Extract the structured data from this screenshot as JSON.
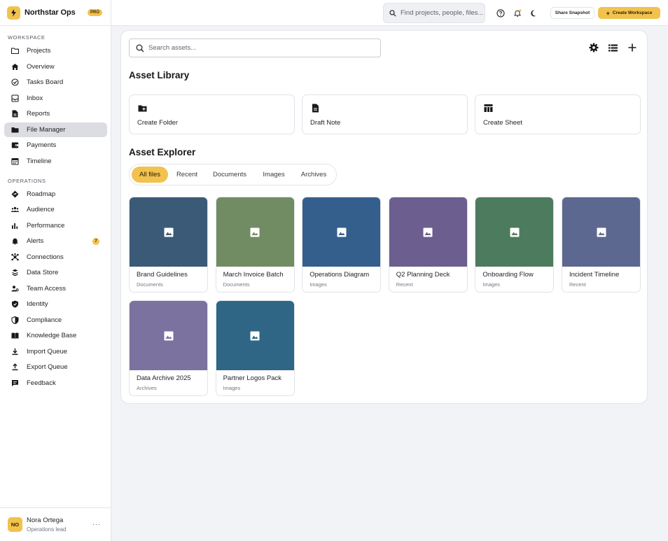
{
  "brand": {
    "name": "Northstar Ops",
    "badge": "PRO"
  },
  "sidebar": {
    "workspace_label": "WORKSPACE",
    "operations_label": "OPERATIONS",
    "workspace_items": [
      {
        "label": "Projects",
        "icon": "folder-outline-icon"
      },
      {
        "label": "Overview",
        "icon": "home-icon"
      },
      {
        "label": "Tasks Board",
        "icon": "check-circle-icon"
      },
      {
        "label": "Inbox",
        "icon": "inbox-icon"
      },
      {
        "label": "Reports",
        "icon": "document-icon"
      },
      {
        "label": "File Manager",
        "icon": "folder-icon",
        "active": true
      },
      {
        "label": "Payments",
        "icon": "wallet-icon"
      },
      {
        "label": "Timeline",
        "icon": "calendar-icon"
      }
    ],
    "operations_items": [
      {
        "label": "Roadmap",
        "icon": "roadmap-icon"
      },
      {
        "label": "Audience",
        "icon": "people-icon"
      },
      {
        "label": "Performance",
        "icon": "bar-chart-icon"
      },
      {
        "label": "Alerts",
        "icon": "bell-icon",
        "badge": "7"
      },
      {
        "label": "Connections",
        "icon": "hub-icon"
      },
      {
        "label": "Data Store",
        "icon": "database-icon"
      },
      {
        "label": "Team Access",
        "icon": "team-key-icon"
      },
      {
        "label": "Identity",
        "icon": "shield-check-icon"
      },
      {
        "label": "Compliance",
        "icon": "shield-half-icon"
      },
      {
        "label": "Knowledge Base",
        "icon": "book-icon"
      },
      {
        "label": "Import Queue",
        "icon": "download-icon"
      },
      {
        "label": "Export Queue",
        "icon": "upload-icon"
      },
      {
        "label": "Feedback",
        "icon": "chat-icon"
      }
    ]
  },
  "user": {
    "initials": "NO",
    "name": "Nora Ortega",
    "role": "Operations lead",
    "more": "···"
  },
  "topbar": {
    "search_placeholder": "Find projects, people, files...",
    "share_label": "Share Snapshot",
    "create_label": "Create Workspace",
    "create_plus": "+"
  },
  "main": {
    "search_placeholder": "Search assets...",
    "library_title": "Asset Library",
    "actions": [
      {
        "label": "Create Folder",
        "icon": "folder-add-icon"
      },
      {
        "label": "Draft Note",
        "icon": "note-icon"
      },
      {
        "label": "Create Sheet",
        "icon": "table-icon"
      }
    ],
    "explorer_title": "Asset Explorer",
    "tabs": [
      "All files",
      "Recent",
      "Documents",
      "Images",
      "Archives"
    ],
    "active_tab": "All files",
    "assets": [
      {
        "name": "Brand Guidelines",
        "category": "Documents",
        "color": "#3a5a78"
      },
      {
        "name": "March Invoice Batch",
        "category": "Documents",
        "color": "#718c63"
      },
      {
        "name": "Operations Diagram",
        "category": "Images",
        "color": "#345f8c"
      },
      {
        "name": "Q2 Planning Deck",
        "category": "Recent",
        "color": "#6c5e8e"
      },
      {
        "name": "Onboarding Flow",
        "category": "Images",
        "color": "#4d7b5d"
      },
      {
        "name": "Incident Timeline",
        "category": "Recent",
        "color": "#5d6890"
      },
      {
        "name": "Data Archive 2025",
        "category": "Archives",
        "color": "#7b72a0"
      },
      {
        "name": "Partner Logos Pack",
        "category": "Images",
        "color": "#2f6686"
      }
    ]
  },
  "colors": {
    "accent": "#f2c24e",
    "active_nav": "#dcdde2"
  }
}
